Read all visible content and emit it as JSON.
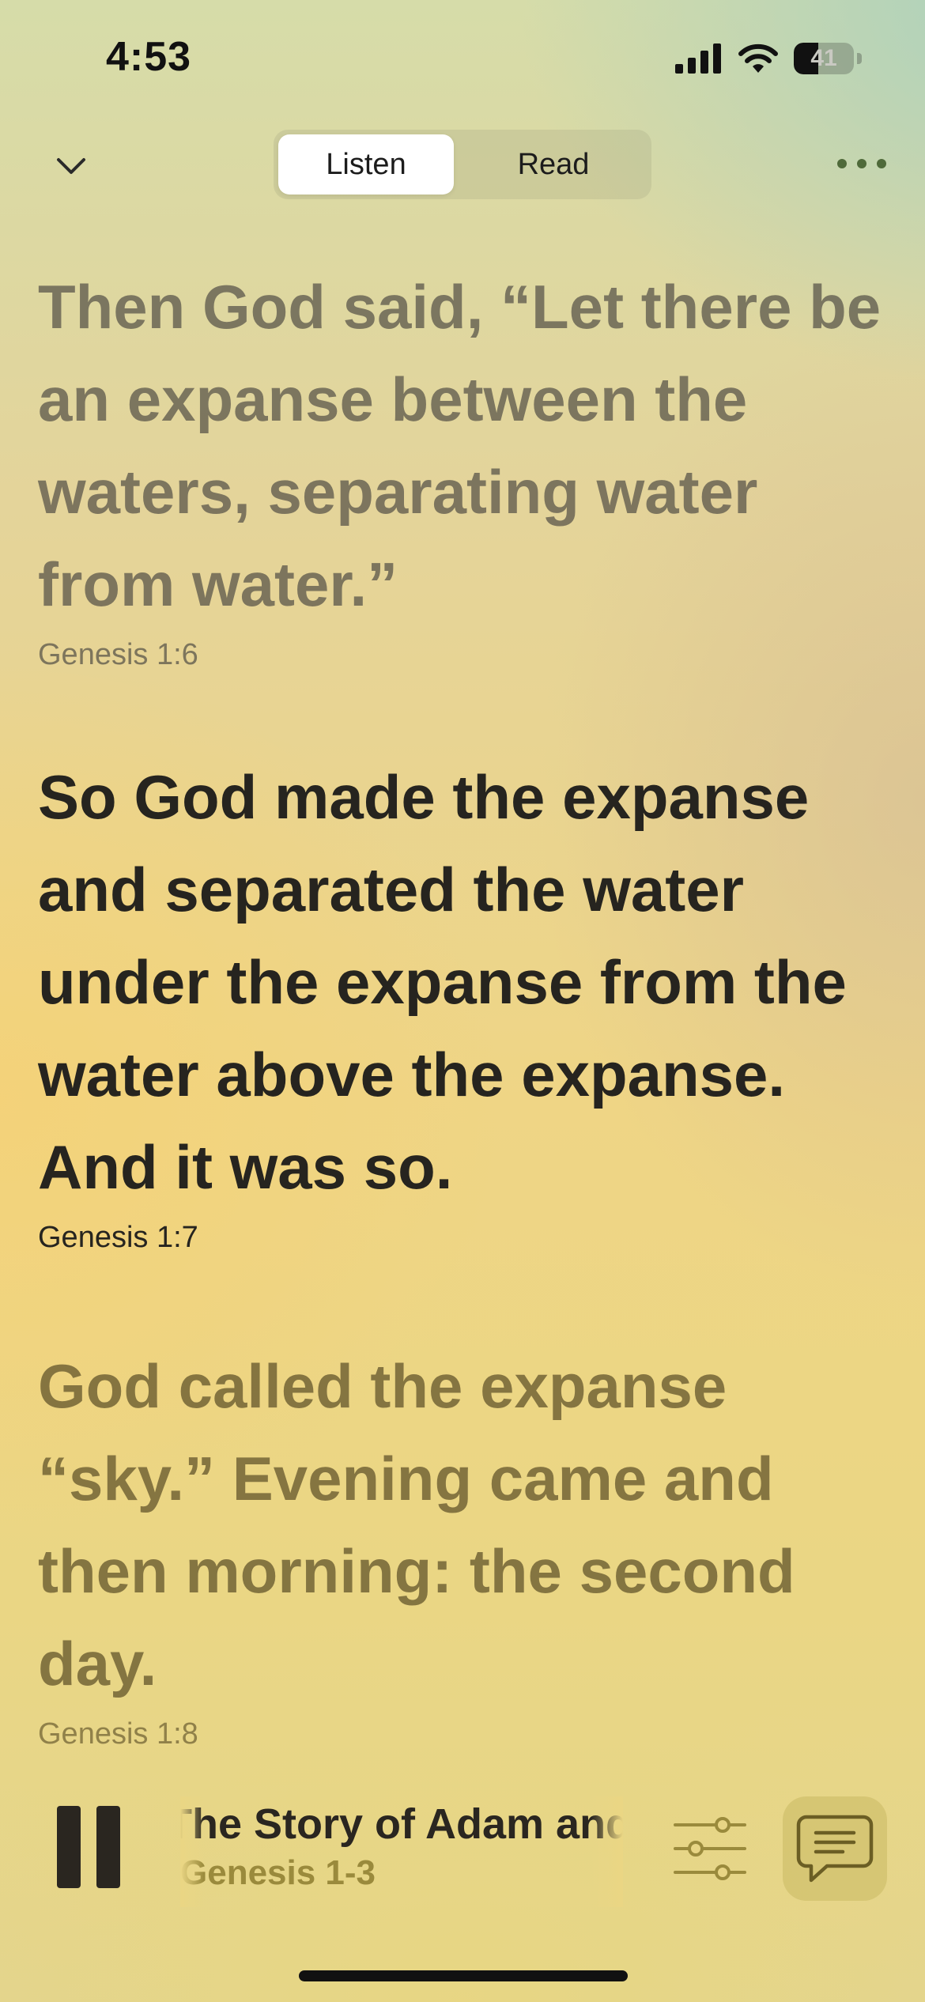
{
  "status_bar": {
    "time": "4:53",
    "battery_level": "41",
    "battery_fraction": 0.41
  },
  "header": {
    "collapse_icon": "chevron-down-icon",
    "tabs": [
      {
        "label": "Listen",
        "selected": true
      },
      {
        "label": "Read",
        "selected": false
      }
    ],
    "more_icon": "ellipsis-icon"
  },
  "verses": [
    {
      "text": "Then God said, “Let there be an expanse between the waters, separating water from water.”",
      "reference": "Genesis 1:6",
      "state": "past"
    },
    {
      "text": "So God made the expanse and separated the water under the expanse from the water above the expanse. And it was so.",
      "reference": "Genesis 1:7",
      "state": "current"
    },
    {
      "text": "God called the expanse “sky.” Evening came and then morning: the second day.",
      "reference": "Genesis 1:8",
      "state": "upcoming"
    }
  ],
  "player": {
    "play_state": "playing",
    "pause_icon": "pause-icon",
    "title": "The Story of Adam and Eve",
    "subtitle": "Genesis 1-3",
    "settings_icon": "sliders-icon",
    "chat_icon": "chat-bubble-icon"
  },
  "colors": {
    "current_verse": "#26241f",
    "accent": "#9a8a3c",
    "background_top": "#d6dca9",
    "background_mid": "#efd585"
  }
}
